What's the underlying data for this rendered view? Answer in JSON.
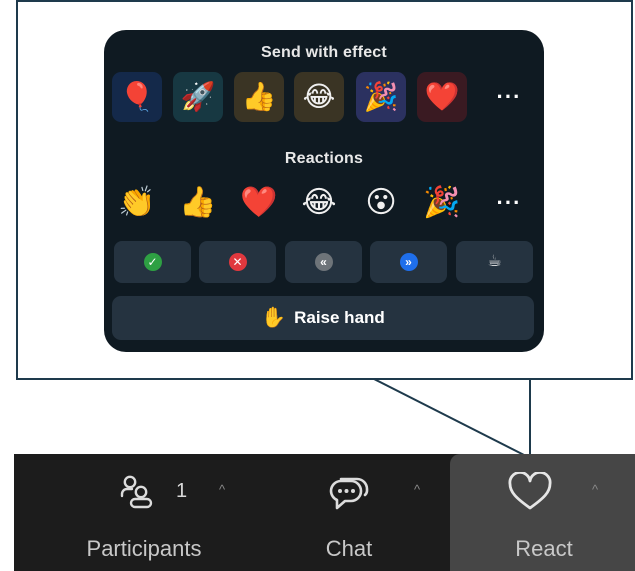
{
  "reactions_panel": {
    "send_with_effect_title": "Send with effect",
    "effects": [
      {
        "name": "balloon",
        "emoji": "🎈",
        "bg": "#14294a"
      },
      {
        "name": "rocket",
        "emoji": "🚀",
        "bg": "#173842"
      },
      {
        "name": "thumbs-up",
        "emoji": "👍",
        "bg": "#3a3424"
      },
      {
        "name": "tears-of-joy",
        "emoji": "😂",
        "bg": "#3a3424"
      },
      {
        "name": "party-popper",
        "emoji": "🎉",
        "bg": "#2b3160"
      },
      {
        "name": "heart",
        "emoji": "❤️",
        "bg": "#3a1a22"
      }
    ],
    "effects_more": "···",
    "reactions_title": "Reactions",
    "reactions": [
      {
        "name": "clapping-hands",
        "emoji": "👏"
      },
      {
        "name": "thumbs-up",
        "emoji": "👍"
      },
      {
        "name": "heart",
        "emoji": "❤️"
      },
      {
        "name": "tears-of-joy",
        "emoji": "😂"
      },
      {
        "name": "open-mouth",
        "emoji": "😮"
      },
      {
        "name": "party-popper",
        "emoji": "🎉"
      }
    ],
    "reactions_more": "···",
    "status_buttons": [
      {
        "name": "yes",
        "glyph": "✓",
        "color": "#2ea043"
      },
      {
        "name": "no",
        "glyph": "✕",
        "color": "#e0383e"
      },
      {
        "name": "go-slower",
        "glyph": "«",
        "color": "#6e7479"
      },
      {
        "name": "go-faster",
        "glyph": "»",
        "color": "#1f6feb"
      },
      {
        "name": "coffee-break",
        "glyph": "☕",
        "color": "transparent"
      }
    ],
    "raise_hand_icon": "✋",
    "raise_hand_label": "Raise hand"
  },
  "toolbar": {
    "participants_label": "Participants",
    "participants_count": "1",
    "chat_label": "Chat",
    "react_label": "React",
    "caret": "^"
  },
  "colors": {
    "panel_bg": "#0f1a22",
    "button_bg": "#253340",
    "toolbar_bg": "#1c1c1c",
    "react_active_bg": "#464646",
    "callout_border": "#1e3a4c"
  }
}
